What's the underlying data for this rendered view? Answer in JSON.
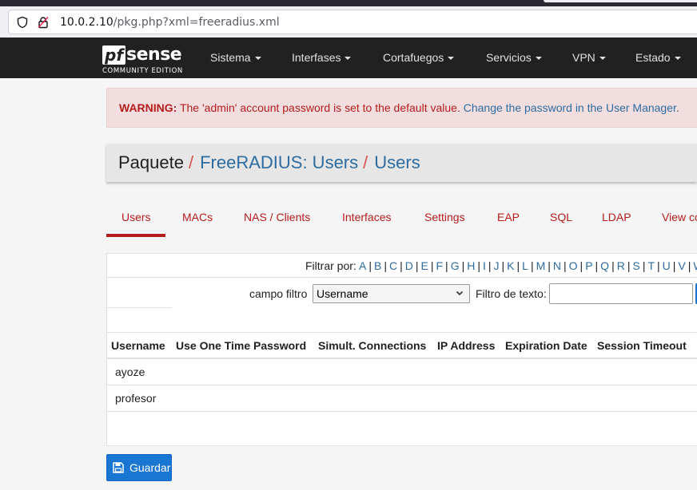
{
  "browser": {
    "url_host": "10.0.2.10",
    "url_path": "/pkg.php?xml=freeradius.xml"
  },
  "nav": {
    "logo_pf": "pf",
    "logo_sense": "sense",
    "logo_edition": "COMMUNITY EDITION",
    "items": [
      {
        "label": "Sistema"
      },
      {
        "label": "Interfases"
      },
      {
        "label": "Cortafuegos"
      },
      {
        "label": "Servicios"
      },
      {
        "label": "VPN"
      },
      {
        "label": "Estado"
      }
    ]
  },
  "warning": {
    "prefix": "WARNING:",
    "text": " The 'admin' account password is set to the default value. ",
    "link": "Change the password in the User Manager."
  },
  "breadcrumb": {
    "root": "Paquete",
    "sep": "/",
    "level1": "FreeRADIUS: Users",
    "level2": "Users"
  },
  "tabs": [
    {
      "label": "Users"
    },
    {
      "label": "MACs"
    },
    {
      "label": "NAS / Clients"
    },
    {
      "label": "Interfaces"
    },
    {
      "label": "Settings"
    },
    {
      "label": "EAP"
    },
    {
      "label": "SQL"
    },
    {
      "label": "LDAP"
    },
    {
      "label": "View co"
    }
  ],
  "filter": {
    "label": "Filtrar por:",
    "letters": [
      "A",
      "B",
      "C",
      "D",
      "E",
      "F",
      "G",
      "H",
      "I",
      "J",
      "K",
      "L",
      "M",
      "N",
      "O",
      "P",
      "Q",
      "R",
      "S",
      "T",
      "U",
      "V",
      "W"
    ],
    "field_label": "campo filtro",
    "field_value": "Username",
    "text_label": "Filtro de texto:",
    "text_value": ""
  },
  "table": {
    "headers": [
      "Username",
      "Use One Time Password",
      "Simult. Connections",
      "IP Address",
      "Expiration Date",
      "Session Timeout"
    ],
    "rows": [
      {
        "username": "ayoze"
      },
      {
        "username": "profesor"
      }
    ]
  },
  "actions": {
    "save_label": "Guardar"
  },
  "colors": {
    "navbar": "#212121",
    "accent_red": "#b71c1c",
    "link_blue": "#2d6ca2",
    "button_blue": "#1976d2"
  }
}
